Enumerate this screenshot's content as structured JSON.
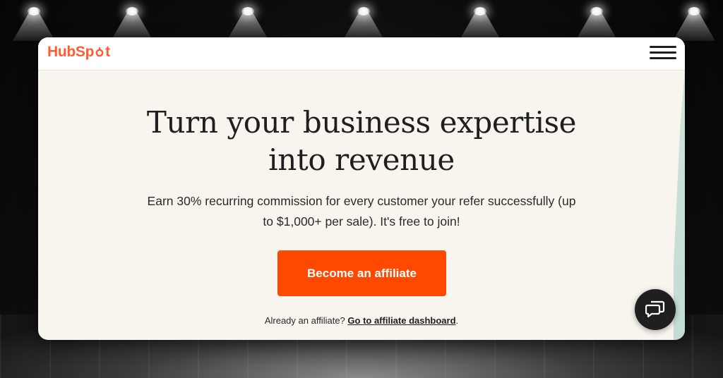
{
  "brand": {
    "logo_text_prefix": "HubSp",
    "logo_text_suffix": "t",
    "logo_name": "HubSpot",
    "accent_color": "#ff4800",
    "logo_color": "#ff5c35"
  },
  "header": {
    "menu_icon": "hamburger-menu-icon"
  },
  "hero": {
    "headline_line1": "Turn your business expertise",
    "headline_line2": "into revenue",
    "subtext_line1": "Earn 30% recurring commission for every customer your refer successfully (up",
    "subtext_line2": "to $1,000+ per sale). It's free to join!",
    "cta_label": "Become an affiliate"
  },
  "footer_note": {
    "prefix": "Already an affiliate?",
    "link_text": "Go to affiliate dashboard",
    "suffix": "."
  },
  "chat": {
    "icon": "chat-bubbles-icon"
  }
}
